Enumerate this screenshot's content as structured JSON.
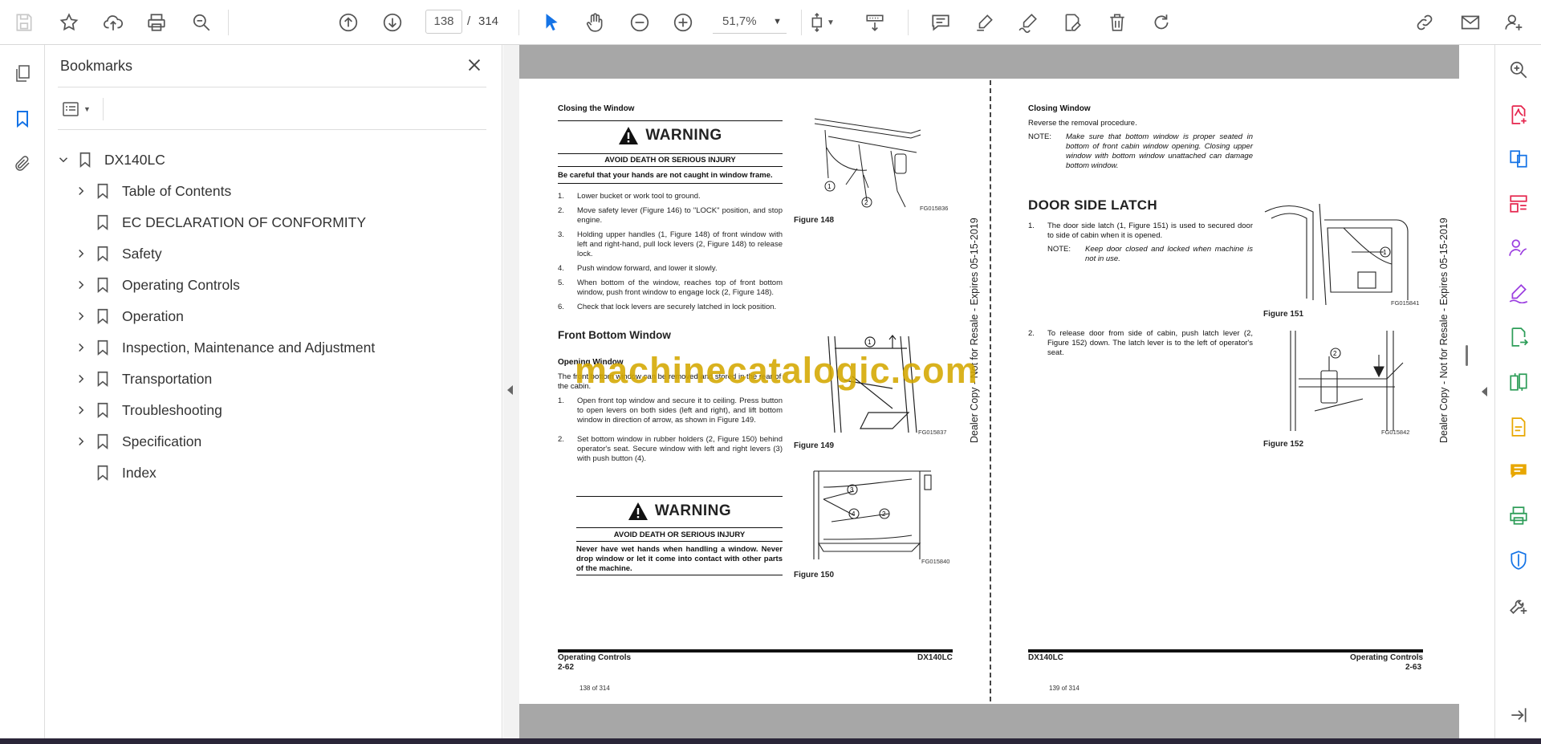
{
  "toolbar": {
    "current_page": "138",
    "page_separator": "/",
    "total_pages": "314",
    "zoom": "51,7%"
  },
  "bookmarks_panel": {
    "title": "Bookmarks",
    "items": [
      {
        "label": "DX140LC",
        "level": 0,
        "expanded": true
      },
      {
        "label": "Table of Contents",
        "level": 1,
        "expandable": true
      },
      {
        "label": "EC DECLARATION OF CONFORMITY",
        "level": 1,
        "expandable": false
      },
      {
        "label": "Safety",
        "level": 1,
        "expandable": true
      },
      {
        "label": "Operating Controls",
        "level": 1,
        "expandable": true
      },
      {
        "label": "Operation",
        "level": 1,
        "expandable": true
      },
      {
        "label": "Inspection, Maintenance and Adjustment",
        "level": 1,
        "expandable": true
      },
      {
        "label": "Transportation",
        "level": 1,
        "expandable": true
      },
      {
        "label": "Troubleshooting",
        "level": 1,
        "expandable": true
      },
      {
        "label": "Specification",
        "level": 1,
        "expandable": true
      },
      {
        "label": "Index",
        "level": 1,
        "expandable": false
      }
    ]
  },
  "left_page": {
    "heading_closing": "Closing the Window",
    "warning_title": "WARNING",
    "warning_sub": "AVOID DEATH OR SERIOUS INJURY",
    "warning_text": "Be careful that your hands are not caught in window frame.",
    "steps": [
      {
        "n": "1.",
        "t": "Lower bucket or work tool to ground."
      },
      {
        "n": "2.",
        "t": "Move safety lever (Figure 146) to \"LOCK\" position, and stop engine."
      },
      {
        "n": "3.",
        "t": "Holding upper handles (1, Figure 148) of front window with left and right-hand, pull lock levers (2, Figure 148) to release lock."
      },
      {
        "n": "4.",
        "t": "Push window forward, and lower it slowly."
      },
      {
        "n": "5.",
        "t": "When bottom of the window, reaches top of front bottom window, push front window to engage lock (2, Figure 148)."
      },
      {
        "n": "6.",
        "t": "Check that lock levers are securely latched in lock position."
      }
    ],
    "section_front_bottom": "Front Bottom Window",
    "heading_opening": "Opening Window",
    "opening_intro": "The front bottom window can be removed and stored in the rear of the cabin.",
    "opening_steps": [
      {
        "n": "1.",
        "t": "Open front top window and secure it to ceiling. Press button to open levers on both sides (left and right), and lift bottom window in direction of arrow, as shown in Figure 149."
      },
      {
        "n": "2.",
        "t": "Set bottom window in rubber holders (2, Figure 150) behind operator's seat. Secure window with left and right levers (3) with push button (4)."
      }
    ],
    "warning2_title": "WARNING",
    "warning2_sub": "AVOID DEATH OR SERIOUS INJURY",
    "warning2_text": "Never have wet hands when handling a window. Never drop window or let it come into contact with other parts of the machine.",
    "fig148": "Figure 148",
    "fig148_code": "FG015836",
    "fig149": "Figure 149",
    "fig149_code": "FG015837",
    "fig150": "Figure 150",
    "fig150_code": "FG015840",
    "footer_left": "Operating Controls",
    "footer_left_num": "2-62",
    "footer_right": "DX140LC",
    "page_counter": "138 of 314",
    "side_text": "Dealer Copy - Not for Resale - Expires 05-15-2019"
  },
  "right_page": {
    "heading_closing": "Closing Window",
    "closing_text": "Reverse the removal procedure.",
    "note_label": "NOTE:",
    "note_text": "Make sure that bottom window is proper seated in bottom of front cabin window opening. Closing upper window with bottom window unattached can damage bottom window.",
    "section_door": "DOOR SIDE LATCH",
    "step1": "The door side latch (1, Figure 151) is used to secured door to side of cabin when it is opened.",
    "note2_label": "NOTE:",
    "note2_text": "Keep door closed and locked when machine is not in use.",
    "step2": "To release door from side of cabin, push latch lever (2, Figure 152) down. The latch lever is to the left of operator's seat.",
    "n1": "1.",
    "n2": "2.",
    "fig151": "Figure 151",
    "fig151_code": "FG015841",
    "fig152": "Figure 152",
    "fig152_code": "FG015842",
    "footer_left": "DX140LC",
    "footer_right": "Operating Controls",
    "footer_right_num": "2-63",
    "page_counter": "139 of 314",
    "side_text": "Dealer Copy - Not for Resale - Expires 05-15-2019"
  },
  "watermark": "machinecatalogic.com",
  "colors": {
    "accent_blue": "#1473e6",
    "pink": "#e5254d",
    "purple": "#9b3ee0",
    "green": "#2d9d58",
    "yellow": "#e8a700",
    "watermark": "#d4a800"
  }
}
